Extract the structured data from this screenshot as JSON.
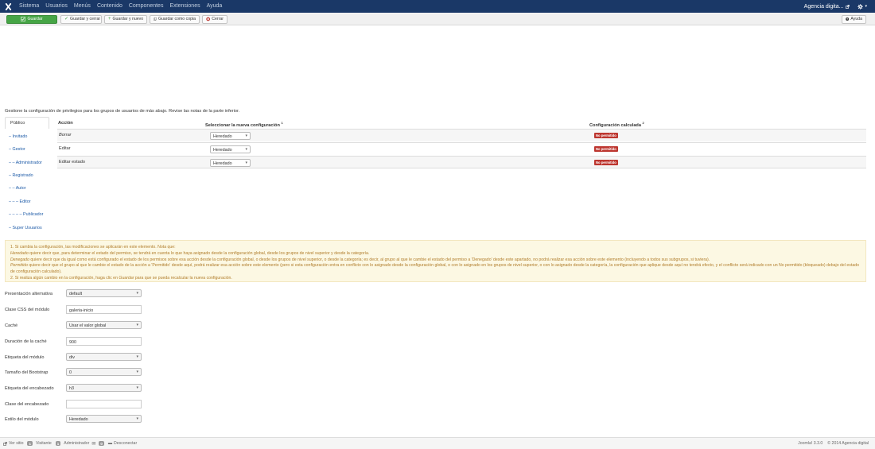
{
  "navbar": {
    "menu": [
      "Sistema",
      "Usuarios",
      "Menús",
      "Contenido",
      "Componentes",
      "Extensiones",
      "Ayuda"
    ],
    "site_name": "Agencia digita...",
    "colors": {
      "bg": "#1a3867"
    }
  },
  "toolbar": {
    "save": "Guardar",
    "save_close": "Guardar y cerrar",
    "save_new": "Guardar y nuevo",
    "save_copy": "Guardar como copia",
    "close": "Cerrar",
    "help": "Ayuda"
  },
  "permissions": {
    "intro": "Gestione la configuración de privilegios para los grupos de usuarios de más abajo. Revise las notas de la parte inferior.",
    "groups": [
      "Público",
      "– Invitado",
      "– Gestor",
      "– – Administrador",
      "– Registrado",
      "– – Autor",
      "– – – Editor",
      "– – – – Publicador",
      "– Super Usuarios"
    ],
    "headers": {
      "action": "Acción",
      "new_setting": "Seleccionar la nueva configuración",
      "new_setting_note": "1",
      "calculated": "Configuración calculada",
      "calculated_note": "2"
    },
    "rows": [
      {
        "action": "Borrar",
        "setting": "Heredado",
        "calculated": "No permitido"
      },
      {
        "action": "Editar",
        "setting": "Heredado",
        "calculated": "No permitido"
      },
      {
        "action": "Editar estado",
        "setting": "Heredado",
        "calculated": "No permitido"
      }
    ]
  },
  "notes": {
    "line1": "1. Si cambia la configuración, las modificaciones se aplicarán en este elemento. Nota que:",
    "inherited_term": "Heredado",
    "inherited_text": " quiere decir que, para determinar el estado del permiso, se tendrá en cuenta lo que haya asignado desde la configuración global, desde los grupos de nivel superior y desde la categoría.",
    "denied_term": "Denegado",
    "denied_text": " quiere decir que da igual como está configurado el estado de los permisos sobre esa acción desde la configuración global, o desde los grupos de nivel superior, o desde la categoría; es decir, al grupo al que le cambie el estado del permiso a 'Denegado' desde este apartado, no podrá realizar esa acción sobre este elemento (incluyendo a todos sus subgrupos, si tuviera).",
    "allowed_term": "Permitido",
    "allowed_text": " quiere decir que el grupo al que le cambie el estado de la acción a 'Permitido' desde aquí, podrá realizar esa acción sobre este elemento (pero si esta configuración entra en conflicto con lo asignado desde la configuración global, o con lo asignado en los grupos de nivel superior, o con lo asignado desde la categoría, la configuración que aplique desde aquí no tendrá efecto, y el conflicto será indicado con un No permitido (bloqueado) debajo del estado de configuración calculado).",
    "line2_pre": "2. Si realiza algún cambio en la configuración, haga clic en ",
    "line2_term": "Guardar",
    "line2_post": " para que se pueda recalcular la nueva configuración."
  },
  "fields": [
    {
      "label": "Presentación alternativa",
      "value": "default",
      "type": "select"
    },
    {
      "label": "Clase CSS del módulo",
      "value": "galeria-inicio",
      "type": "input"
    },
    {
      "label": "Caché",
      "value": "Usar el valor global",
      "type": "select"
    },
    {
      "label": "Duración de la caché",
      "value": "900",
      "type": "input"
    },
    {
      "label": "Etiqueta del módulo",
      "value": "div",
      "type": "select"
    },
    {
      "label": "Tamaño del Bootstrap",
      "value": "0",
      "type": "select"
    },
    {
      "label": "Etiqueta del encabezado",
      "value": "h3",
      "type": "select"
    },
    {
      "label": "Clase del encabezado",
      "value": "",
      "type": "input"
    },
    {
      "label": "Estilo del módulo",
      "value": "Heredado",
      "type": "select"
    }
  ],
  "statusbar": {
    "view_site": "Ver sitio",
    "visitors_count": "1",
    "visitors": "Visitante",
    "admins_count": "1",
    "admins": "Administrador",
    "messages_count": "0",
    "logout": "Desconectar",
    "version": "Joomla! 3.3.0",
    "copyright": "© 2014 Agencia digital"
  }
}
